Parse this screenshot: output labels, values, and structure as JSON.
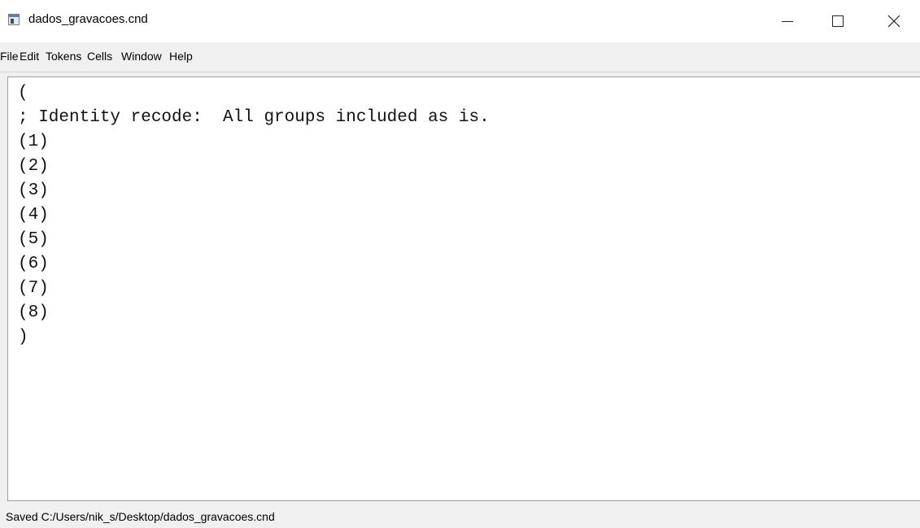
{
  "window": {
    "title": "dados_gravacoes.cnd",
    "icon": "document-window-icon"
  },
  "menubar": {
    "items": [
      "File",
      "Edit",
      "Tokens",
      "Cells",
      "Window",
      "Help"
    ]
  },
  "editor": {
    "lines": [
      "(",
      "; Identity recode:  All groups included as is.",
      "(1)",
      "(2)",
      "(3)",
      "(4)",
      "(5)",
      "(6)",
      "(7)",
      "(8)",
      ")"
    ]
  },
  "statusbar": {
    "text": "Saved C:/Users/nik_s/Desktop/dados_gravacoes.cnd"
  }
}
